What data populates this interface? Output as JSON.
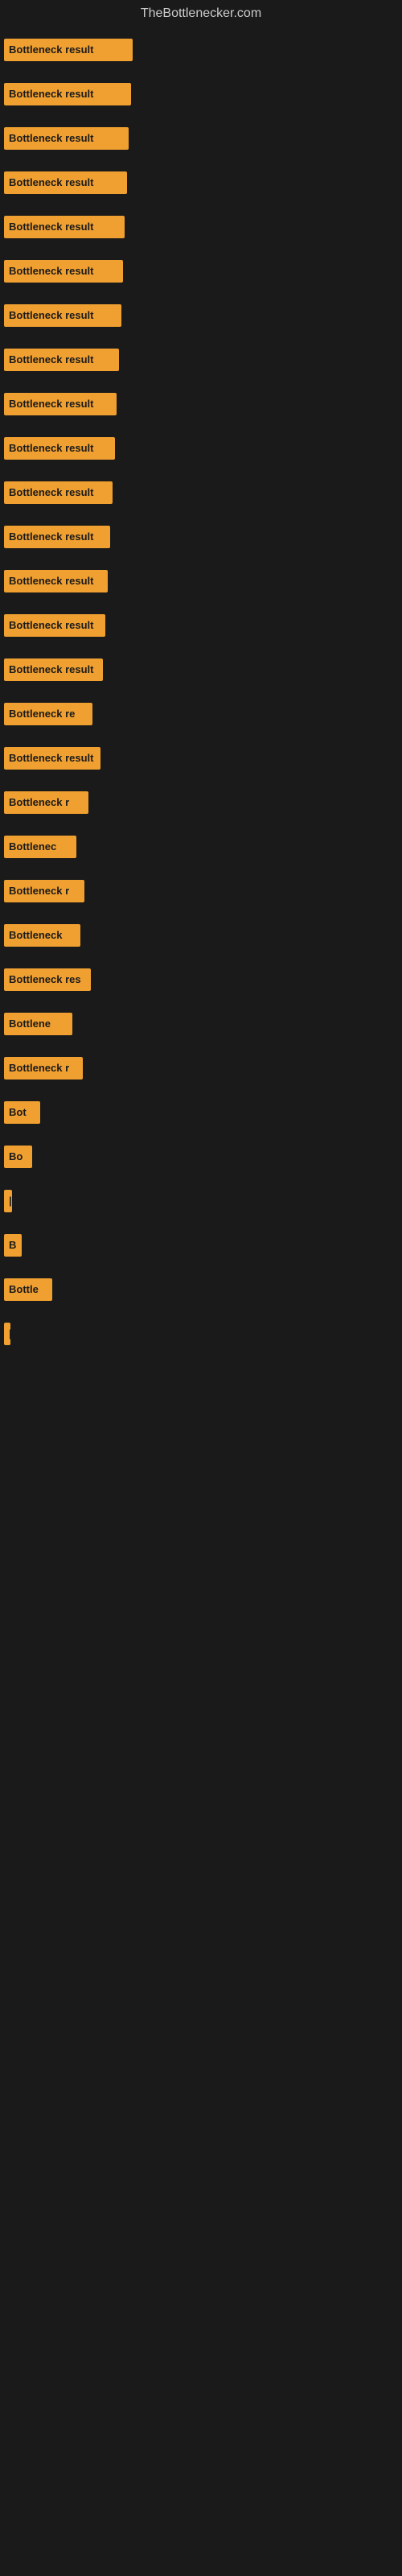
{
  "site": {
    "title": "TheBottlenecker.com"
  },
  "bars": [
    {
      "label": "Bottleneck result",
      "width": 160
    },
    {
      "label": "Bottleneck result",
      "width": 158
    },
    {
      "label": "Bottleneck result",
      "width": 155
    },
    {
      "label": "Bottleneck result",
      "width": 153
    },
    {
      "label": "Bottleneck result",
      "width": 150
    },
    {
      "label": "Bottleneck result",
      "width": 148
    },
    {
      "label": "Bottleneck result",
      "width": 146
    },
    {
      "label": "Bottleneck result",
      "width": 143
    },
    {
      "label": "Bottleneck result",
      "width": 140
    },
    {
      "label": "Bottleneck result",
      "width": 138
    },
    {
      "label": "Bottleneck result",
      "width": 135
    },
    {
      "label": "Bottleneck result",
      "width": 132
    },
    {
      "label": "Bottleneck result",
      "width": 129
    },
    {
      "label": "Bottleneck result",
      "width": 126
    },
    {
      "label": "Bottleneck result",
      "width": 123
    },
    {
      "label": "Bottleneck re",
      "width": 110
    },
    {
      "label": "Bottleneck result",
      "width": 120
    },
    {
      "label": "Bottleneck r",
      "width": 105
    },
    {
      "label": "Bottlenec",
      "width": 90
    },
    {
      "label": "Bottleneck r",
      "width": 100
    },
    {
      "label": "Bottleneck",
      "width": 95
    },
    {
      "label": "Bottleneck res",
      "width": 108
    },
    {
      "label": "Bottlene",
      "width": 85
    },
    {
      "label": "Bottleneck r",
      "width": 98
    },
    {
      "label": "Bot",
      "width": 45
    },
    {
      "label": "Bo",
      "width": 35
    },
    {
      "label": "|",
      "width": 10
    },
    {
      "label": "B",
      "width": 22
    },
    {
      "label": "Bottle",
      "width": 60
    },
    {
      "label": "|",
      "width": 8
    }
  ]
}
